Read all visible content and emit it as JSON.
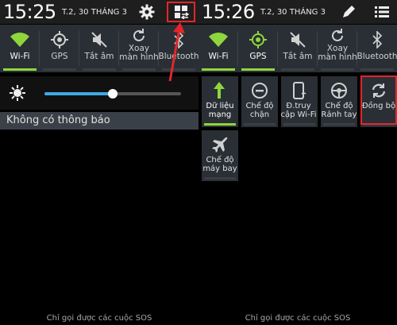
{
  "left": {
    "time": "15:25",
    "date": "T.2, 30 THÁNG 3",
    "toggles": [
      {
        "label": "Wi-Fi",
        "on": true,
        "icon": "wifi-icon"
      },
      {
        "label": "GPS",
        "on": false,
        "icon": "gps-icon"
      },
      {
        "label": "Tắt âm",
        "on": false,
        "icon": "mute-icon"
      },
      {
        "label": "Xoay màn hình",
        "on": false,
        "icon": "rotate-icon"
      },
      {
        "label": "Bluetooth",
        "on": false,
        "icon": "bluetooth-icon"
      }
    ],
    "brightness": 0.5,
    "no_notifications": "Không có thông báo",
    "sos": "Chỉ gọi được các cuộc SOS"
  },
  "right": {
    "time": "15:26",
    "date": "T.2, 30 THÁNG 3",
    "toggles": [
      {
        "label": "Wi-Fi",
        "on": true,
        "icon": "wifi-icon"
      },
      {
        "label": "GPS",
        "on": true,
        "icon": "gps-icon"
      },
      {
        "label": "Tắt âm",
        "on": false,
        "icon": "mute-icon"
      },
      {
        "label": "Xoay màn hình",
        "on": false,
        "icon": "rotate-icon"
      },
      {
        "label": "Bluetooth",
        "on": false,
        "icon": "bluetooth-icon"
      }
    ],
    "tiles": [
      {
        "label": "Dữ liệu mạng",
        "on": true,
        "icon": "data-icon"
      },
      {
        "label": "Chế độ chặn",
        "on": false,
        "icon": "block-icon"
      },
      {
        "label": "Đ.truy cập Wi-Fi",
        "on": false,
        "icon": "hotspot-icon"
      },
      {
        "label": "Chế độ Rảnh tay",
        "on": false,
        "icon": "handsfree-icon"
      },
      {
        "label": "Đồng bộ",
        "on": false,
        "icon": "sync-icon"
      },
      {
        "label": "Chế độ máy bay",
        "on": false,
        "icon": "airplane-icon"
      }
    ],
    "sos": "Chỉ gọi được các cuộc SOS"
  },
  "colors": {
    "accent_green": "#8fd63c",
    "highlight_red": "#e3262b",
    "slider_blue": "#3fa8e6"
  }
}
